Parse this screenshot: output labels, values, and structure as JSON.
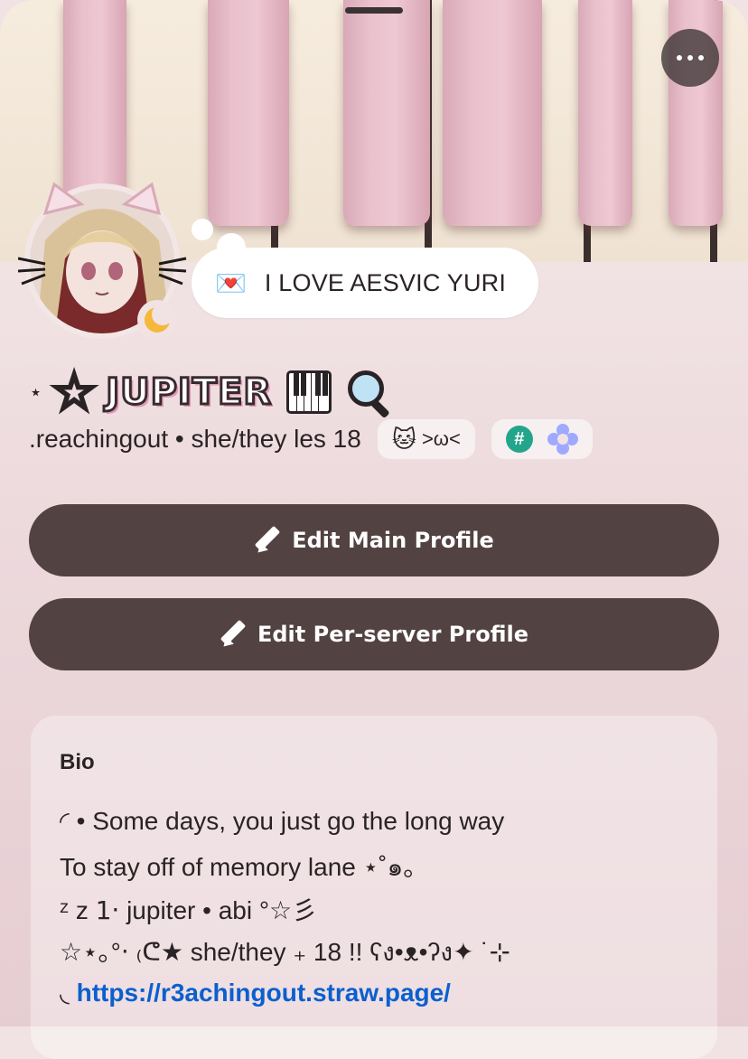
{
  "header": {
    "more_icon": "more-horizontal-icon"
  },
  "status": {
    "emoji": "💌",
    "text": "I LOVE AESVIC YURI",
    "presence_icon": "moon-icon"
  },
  "profile": {
    "name_prefix": "⋆",
    "name_star": "☆",
    "display_name": "JUPITER",
    "name_icons": [
      "piano-icon",
      "magnifying-glass-icon"
    ],
    "handle_line": ".reachingout • she/they les 18",
    "badge_cat_emoji": "🐱",
    "badge_label": ">ω<",
    "hash_symbol": "#"
  },
  "buttons": {
    "edit_main": "Edit Main Profile",
    "edit_server": "Edit Per-server Profile"
  },
  "bio": {
    "title": "Bio",
    "line1": "◜ • Some days, you just go the long way",
    "line2": "To stay off of memory lane ⋆˚๑。",
    "line3": "ᶻ z 𝟣‧ jupiter • abi °☆彡",
    "line4": "☆⋆｡°‧ ₍ᕦ★ she/they ₊ 18 !! ʕง•ᴥ•ʔง✦ ˙⊹",
    "line5_prefix": "◟",
    "link": "https://r3achingout.straw.page/"
  },
  "colors": {
    "button_bg": "#524241",
    "link": "#0b5fcf",
    "name_shadow": "#e09ab4"
  }
}
